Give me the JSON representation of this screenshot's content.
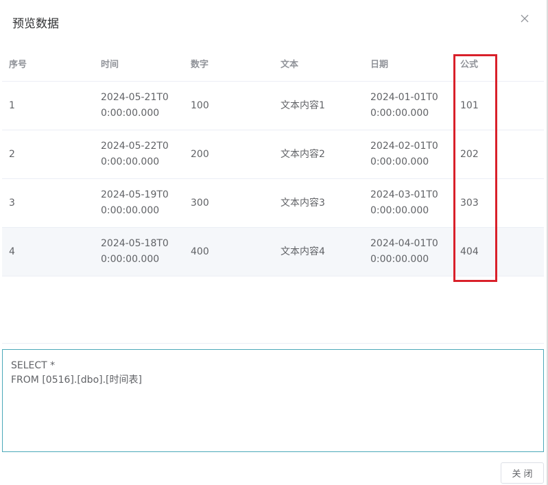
{
  "dialog": {
    "title": "预览数据",
    "close_icon": "close-icon"
  },
  "table": {
    "columns": [
      "序号",
      "时间",
      "数字",
      "文本",
      "日期",
      "公式"
    ],
    "rows": [
      [
        "1",
        "2024-05-21T00:00:00.000",
        "100",
        "文本内容1",
        "2024-01-01T00:00:00.000",
        "101"
      ],
      [
        "2",
        "2024-05-22T00:00:00.000",
        "200",
        "文本内容2",
        "2024-02-01T00:00:00.000",
        "202"
      ],
      [
        "3",
        "2024-05-19T00:00:00.000",
        "300",
        "文本内容3",
        "2024-03-01T00:00:00.000",
        "303"
      ],
      [
        "4",
        "2024-05-18T00:00:00.000",
        "400",
        "文本内容4",
        "2024-04-01T00:00:00.000",
        "404"
      ]
    ],
    "hovered_row": 4
  },
  "sql": {
    "text": "SELECT *\nFROM [0516].[dbo].[时间表]"
  },
  "footer": {
    "close_label": "关闭"
  },
  "colors": {
    "highlight_border": "#d9202a",
    "sql_border": "#4aa8b8",
    "hover_row": "#f5f7fa"
  }
}
